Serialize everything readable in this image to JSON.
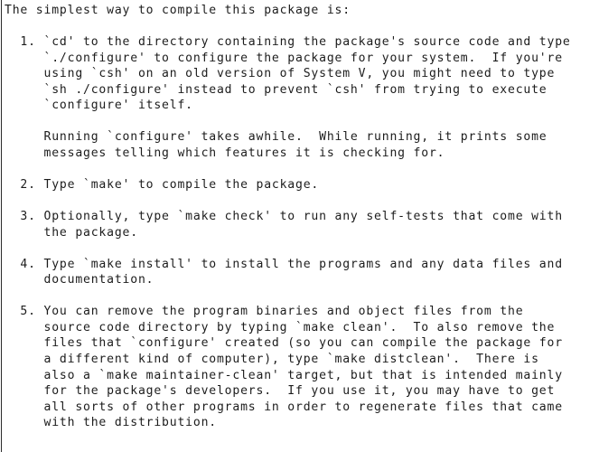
{
  "document": {
    "kind": "plain-text-document",
    "font_style": "monospace",
    "text_color": "#1c1c1c",
    "background_color": "#ffffff",
    "left_rule_color": "#2b2b2b",
    "intro": "The simplest way to compile this package is:",
    "lines": [
      "The simplest way to compile this package is:",
      "",
      "  1. `cd' to the directory containing the package's source code and type",
      "     `./configure' to configure the package for your system.  If you're",
      "     using `csh' on an old version of System V, you might need to type",
      "     `sh ./configure' instead to prevent `csh' from trying to execute",
      "     `configure' itself.",
      "",
      "     Running `configure' takes awhile.  While running, it prints some",
      "     messages telling which features it is checking for.",
      "",
      "  2. Type `make' to compile the package.",
      "",
      "  3. Optionally, type `make check' to run any self-tests that come with",
      "     the package.",
      "",
      "  4. Type `make install' to install the programs and any data files and",
      "     documentation.",
      "",
      "  5. You can remove the program binaries and object files from the",
      "     source code directory by typing `make clean'.  To also remove the",
      "     files that `configure' created (so you can compile the package for",
      "     a different kind of computer), type `make distclean'.  There is",
      "     also a `make maintainer-clean' target, but that is intended mainly",
      "     for the package's developers.  If you use it, you may have to get",
      "     all sorts of other programs in order to regenerate files that came",
      "     with the distribution."
    ],
    "steps": [
      {
        "number": "1.",
        "text": "`cd' to the directory containing the package's source code and type `./configure' to configure the package for your system.  If you're using `csh' on an old version of System V, you might need to type `sh ./configure' instead to prevent `csh' from trying to execute `configure' itself.",
        "note": "Running `configure' takes awhile.  While running, it prints some messages telling which features it is checking for."
      },
      {
        "number": "2.",
        "text": "Type `make' to compile the package."
      },
      {
        "number": "3.",
        "text": "Optionally, type `make check' to run any self-tests that come with the package."
      },
      {
        "number": "4.",
        "text": "Type `make install' to install the programs and any data files and documentation."
      },
      {
        "number": "5.",
        "text": "You can remove the program binaries and object files from the source code directory by typing `make clean'.  To also remove the files that `configure' created (so you can compile the package for a different kind of computer), type `make distclean'.  There is also a `make maintainer-clean' target, but that is intended mainly for the package's developers.  If you use it, you may have to get all sorts of other programs in order to regenerate files that came with the distribution."
      }
    ]
  }
}
